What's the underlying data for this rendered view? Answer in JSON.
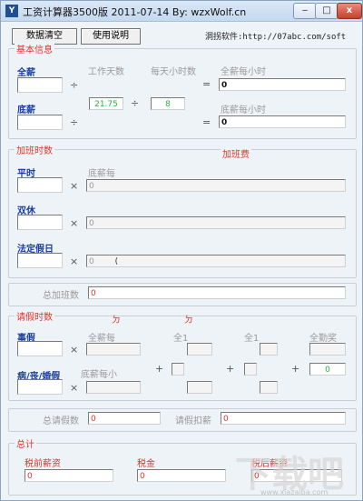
{
  "window": {
    "title": "工资计算器3500版  2011-07-14  By: wzxWolf.cn",
    "icon": "app-logo-icon"
  },
  "controls": {
    "minimize": "‒",
    "maximize": "□",
    "close": "x"
  },
  "toolbar": {
    "clear_label": "数据清空",
    "help_label": "使用说明",
    "link_label": "洞拐软件:http://07abc.com/soft"
  },
  "basic": {
    "title": "基本信息",
    "full_salary_label": "全薪",
    "work_days_label": "工作天数",
    "daily_hours_label": "每天小时数",
    "full_hourly_label": "全薪每小时",
    "base_salary_label": "底薪",
    "base_hourly_label": "底薪每小时",
    "work_days_value": "21.75",
    "daily_hours_value": "8",
    "full_hourly_value": "0",
    "base_hourly_value": "0",
    "full_salary_value": "",
    "base_salary_value": ""
  },
  "overtime": {
    "title": "加班时数",
    "pay_title": "加班费",
    "normal_label": "平时",
    "base_per_label": "底薪每",
    "normal_value": "0",
    "weekend_label": "双休",
    "weekend_value": "0",
    "holiday_label": "法定假日",
    "holiday_value": "0",
    "cursor_char": "(",
    "total_label": "总加班数",
    "total_value": "0"
  },
  "leave": {
    "title": "请假时数",
    "mark1": "ㄉ",
    "mark2": "ㄉ",
    "personal_label": "事假",
    "full_per_label": "全薪每",
    "full_a_label": "全1",
    "full_b_label": "全1",
    "attendance_label": "全勤奖",
    "attendance_value": "0",
    "sick_label": "病/丧/婚假",
    "base_per_label": "底薪每小",
    "total_label": "总请假数",
    "total_value": "0",
    "deduct_label": "请假扣薪",
    "deduct_value": "0"
  },
  "summary": {
    "title": "总计",
    "pretax_label": "税前薪资",
    "pretax_value": "0",
    "tax_label": "税金",
    "tax_value": "0",
    "aftertax_label": "税后薪资",
    "aftertax_value": "0"
  },
  "watermark": {
    "logo": "下载吧",
    "url": "www.xiazaiba.com"
  },
  "operators": {
    "divide": "÷",
    "multiply": "×",
    "equals": "=",
    "plus": "+"
  }
}
